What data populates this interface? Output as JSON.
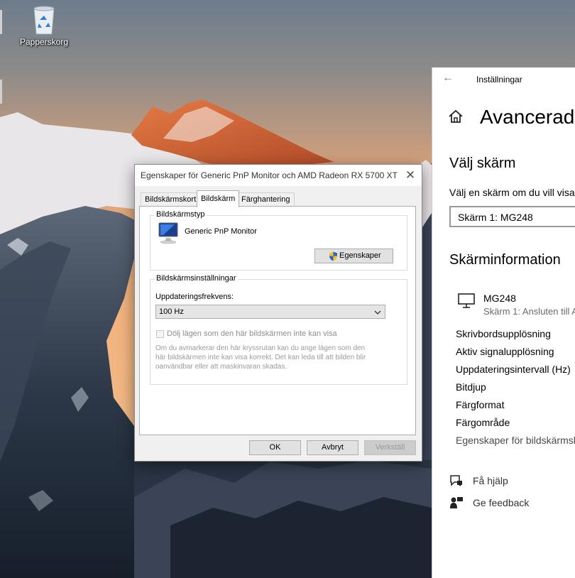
{
  "desktop": {
    "recycle_bin_label": "Papperskorg"
  },
  "dialog": {
    "title": "Egenskaper för Generic PnP Monitor och AMD Radeon RX 5700 XT",
    "tabs": [
      {
        "label": "Bildskärmskort",
        "active": false
      },
      {
        "label": "Bildskärm",
        "active": true
      },
      {
        "label": "Färghantering",
        "active": false
      }
    ],
    "monitor_type": {
      "legend": "Bildskärmstyp",
      "monitor_name": "Generic PnP Monitor",
      "properties_button": "Egenskaper"
    },
    "monitor_settings": {
      "legend": "Bildskärmsinställningar",
      "refresh_label": "Uppdateringsfrekvens:",
      "refresh_value": "100 Hz",
      "hide_modes_label": "Dölj lägen som den här bildskärmen inte kan visa",
      "hide_modes_checked": false,
      "warning_lines": [
        "Om du avmarkerar den här kryssrutan kan du ange lägen som den",
        "här bildskärmen inte kan visa korrekt. Det kan leda till att bilden blir",
        "oanvändbar eller att maskinvaran skadas."
      ]
    },
    "buttons": {
      "ok": "OK",
      "cancel": "Avbryt",
      "apply": "Verkställ"
    }
  },
  "settings": {
    "window_title": "Inställningar",
    "page_heading": "Avancerade",
    "choose_display_heading": "Välj skärm",
    "choose_display_text": "Välj en skärm om du vill visa",
    "selected_display": "Skärm 1: MG248",
    "display_info_heading": "Skärminformation",
    "monitor_name": "MG248",
    "monitor_subtitle": "Skärm 1: Ansluten till A",
    "info_rows": [
      "Skrivbordsupplösning",
      "Aktiv signalupplösning",
      "Uppdateringsintervall (Hz)",
      "Bitdjup",
      "Färgformat",
      "Färgområde"
    ],
    "adapter_link": "Egenskaper för bildskärmsk",
    "help_link": "Få hjälp",
    "feedback_link": "Ge feedback"
  }
}
